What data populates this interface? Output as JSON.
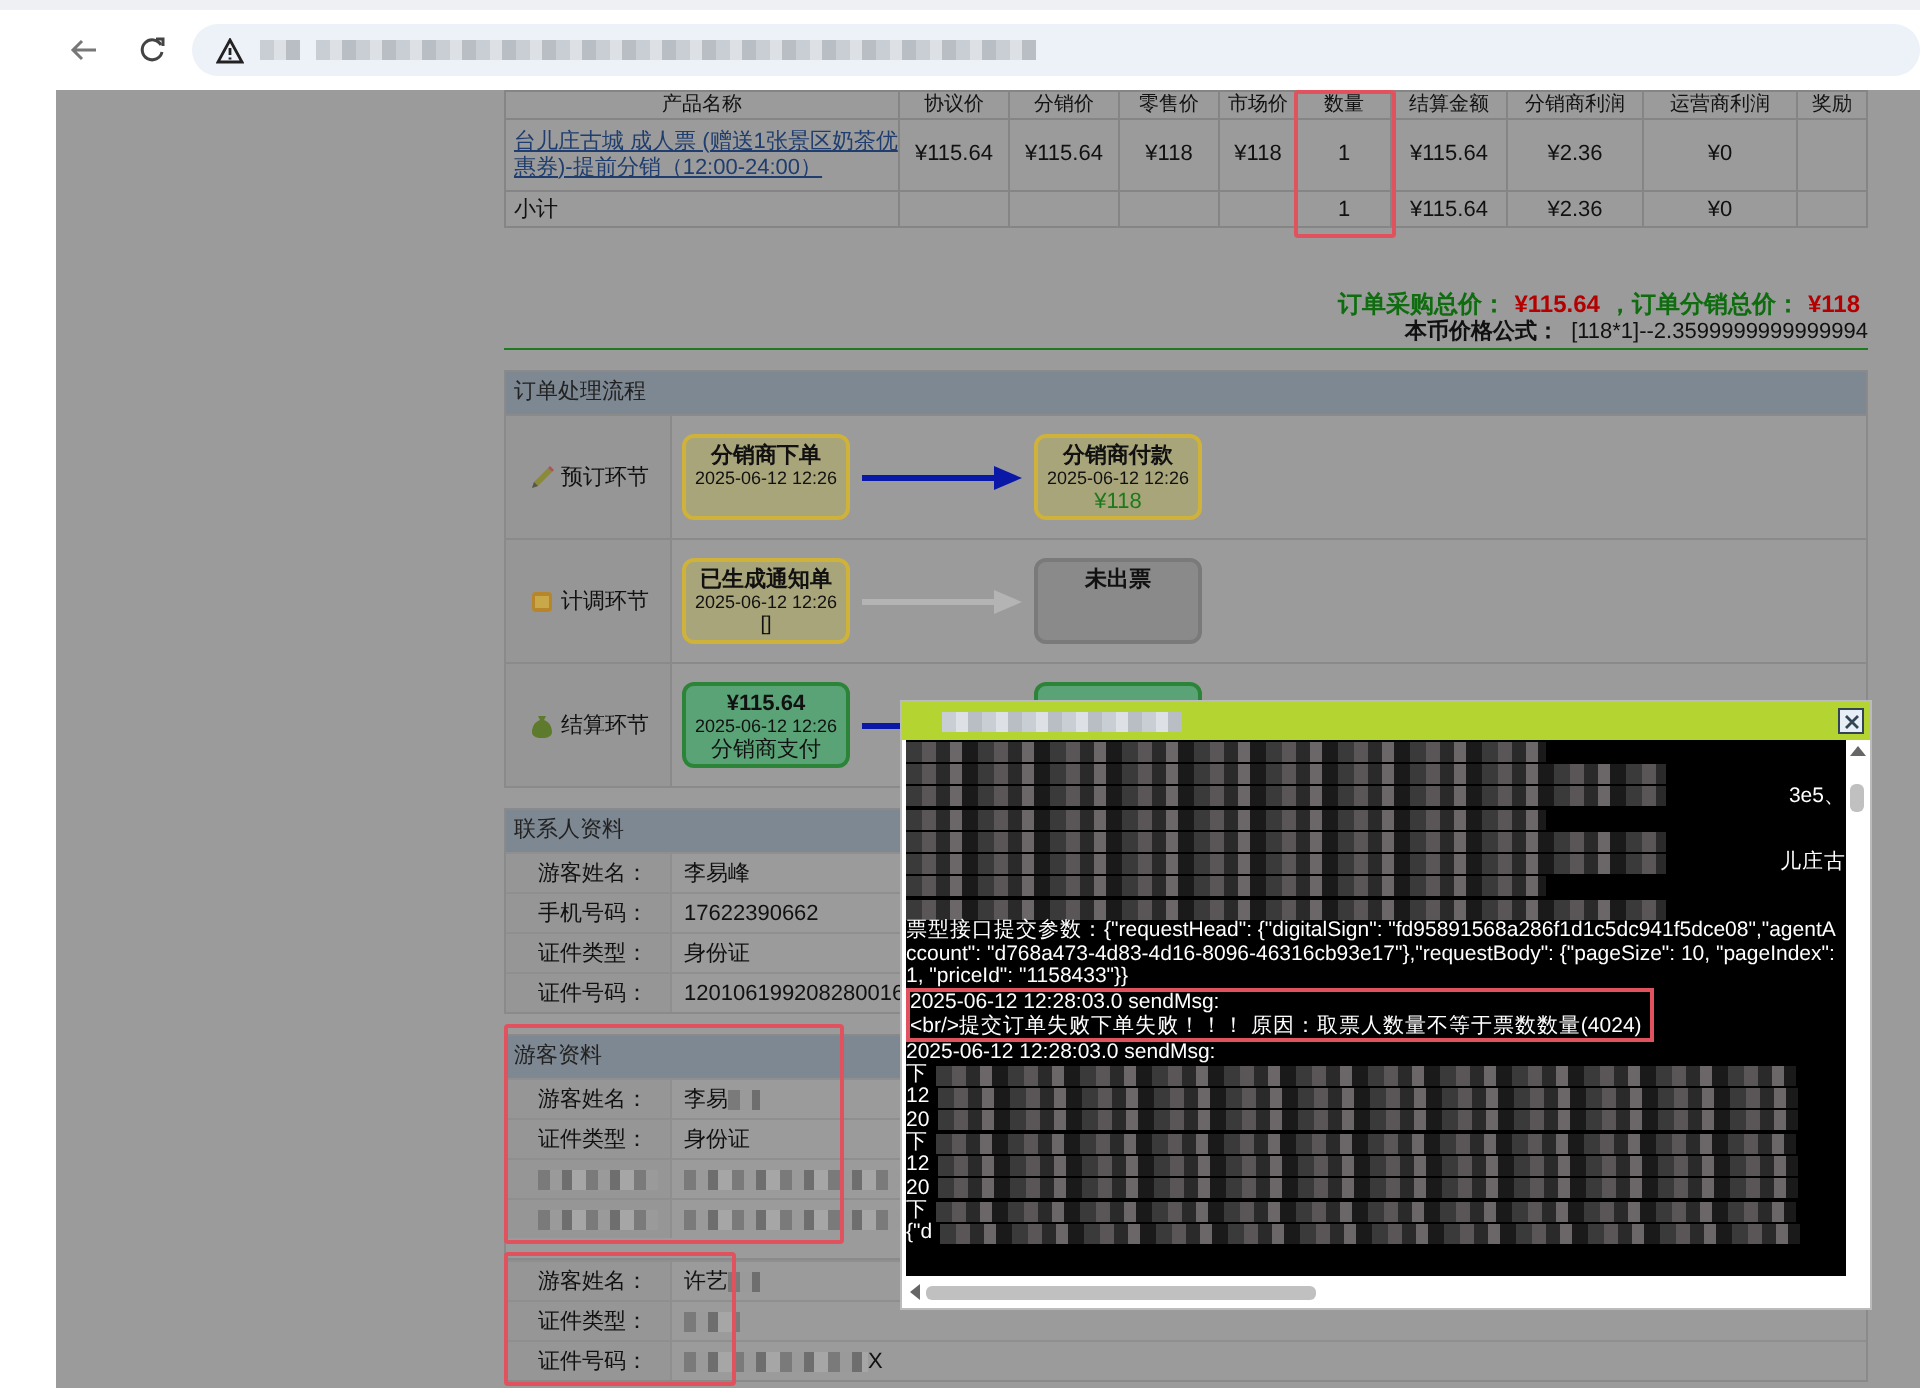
{
  "toolbar": {
    "address": {
      "redacted": true
    }
  },
  "product_table": {
    "columns": [
      {
        "label": "产品名称",
        "highlighted": false
      },
      {
        "label": "协议价",
        "highlighted": false
      },
      {
        "label": "分销价",
        "highlighted": false
      },
      {
        "label": "零售价",
        "highlighted": false
      },
      {
        "label": "市场价",
        "highlighted": false
      },
      {
        "label": "数量",
        "highlighted": true
      },
      {
        "label": "结算金额",
        "highlighted": false
      },
      {
        "label": "分销商利润",
        "highlighted": false
      },
      {
        "label": "运营商利润",
        "highlighted": false
      },
      {
        "label": "奖励",
        "highlighted": false
      }
    ],
    "rows": [
      {
        "kind": "item",
        "cells": [
          "台儿庄古城 成人票 (赠送1张景区奶茶优惠券)-提前分销（12:00-24:00）",
          "¥115.64",
          "¥115.64",
          "¥118",
          "¥118",
          "1",
          "¥115.64",
          "¥2.36",
          "¥0",
          null
        ]
      },
      {
        "kind": "subtotal",
        "cells": [
          "小计",
          null,
          null,
          null,
          null,
          "1",
          "¥115.64",
          "¥2.36",
          "¥0",
          null
        ]
      }
    ]
  },
  "totals": {
    "purchase_label": "订单采购总价：",
    "purchase_value": "¥115.64",
    "distribution_label": "，订单分销总价：",
    "distribution_value": "¥118",
    "formula_label": "本币价格公式：",
    "formula_value": "[118*1]--2.3599999999999994"
  },
  "flow": {
    "title": "订单处理流程",
    "stages": [
      {
        "label": "预订环节",
        "steps": [
          {
            "kind": "pending",
            "lines": [
              {
                "kind": "title",
                "text": "分销商下单"
              },
              {
                "kind": "time",
                "text": "2025-06-12 12:26"
              }
            ]
          },
          {
            "kind": "pending",
            "arrow_active": true,
            "lines": [
              {
                "kind": "title",
                "text": "分销商付款"
              },
              {
                "kind": "time",
                "text": "2025-06-12 12:26"
              },
              {
                "kind": "amount",
                "text": "¥118"
              }
            ]
          }
        ]
      },
      {
        "label": "计调环节",
        "steps": [
          {
            "kind": "pending",
            "lines": [
              {
                "kind": "title",
                "text": "已生成通知单"
              },
              {
                "kind": "time",
                "text": "2025-06-12 12:26"
              },
              {
                "kind": "note",
                "text": "[]"
              }
            ]
          },
          {
            "kind": "inactive",
            "arrow_active": false,
            "lines": [
              {
                "kind": "title",
                "text": "未出票"
              }
            ]
          }
        ]
      },
      {
        "label": "结算环节",
        "steps": [
          {
            "kind": "paid",
            "lines": [
              {
                "kind": "title",
                "text": "¥115.64"
              },
              {
                "kind": "time",
                "text": "2025-06-12 12:26"
              },
              {
                "kind": "big",
                "text": "分销商支付"
              }
            ]
          },
          {
            "kind": "paid",
            "arrow_active": true
          }
        ]
      }
    ]
  },
  "contact": {
    "title": "联系人资料",
    "fields": [
      {
        "label": "游客姓名：",
        "value": "李易峰"
      },
      {
        "label": "手机号码：",
        "value": "17622390662"
      },
      {
        "label": "证件类型：",
        "value": "身份证"
      },
      {
        "label": "证件号码：",
        "value": "120106199208280016"
      }
    ]
  },
  "tourists": {
    "title": "游客资料",
    "groups": [
      {
        "highlighted": true,
        "fields": [
          {
            "label": "游客姓名：",
            "value": "李易",
            "value_redacted": true
          },
          {
            "label": "证件类型：",
            "value": "身份证"
          },
          {
            "label_redacted": true,
            "value_redacted": true
          },
          {
            "label_redacted": true,
            "value_redacted": true
          }
        ]
      },
      {
        "highlighted": true,
        "fields": [
          {
            "label": "游客姓名：",
            "value": "许艺",
            "value_redacted": true
          },
          {
            "label": "证件类型：",
            "value_redacted": true
          },
          {
            "label": "证件号码：",
            "value_redacted": true,
            "value_suffix": "X"
          }
        ]
      }
    ]
  },
  "dialog": {
    "title": {
      "redacted": true
    },
    "lines": [
      {
        "kind": "redacted"
      },
      {
        "kind": "redacted"
      },
      {
        "kind": "redacted",
        "tail": "3e5、"
      },
      {
        "kind": "redacted"
      },
      {
        "kind": "redacted"
      },
      {
        "kind": "redacted",
        "tail": "儿庄古"
      },
      {
        "kind": "redacted"
      },
      {
        "kind": "redacted"
      },
      {
        "kind": "text",
        "highlighted": false,
        "text": "票型接口提交参数：{\"requestHead\": {\"digitalSign\": \"fd95891568a286f1d1c5dc941f5dce08\",\"agentAccount\": \"d768a473-4d83-4d16-8096-46316cb93e17\"},\"requestBody\": {\"pageSize\": 10, \"pageIndex\":1, \"priceId\": \"1158433\"}}"
      },
      {
        "kind": "text",
        "highlighted": true,
        "text": "2025-06-12 12:28:03.0 sendMsg:"
      },
      {
        "kind": "text",
        "highlighted": true,
        "text": "<br/>提交订单失败下单失败！！！ 原因：取票人数量不等于票数数量(4024)"
      },
      {
        "kind": "text",
        "highlighted": false,
        "text": "2025-06-12 12:28:03.0 sendMsg:"
      },
      {
        "kind": "redacted",
        "head": "下"
      },
      {
        "kind": "redacted",
        "head": "12"
      },
      {
        "kind": "redacted",
        "head": "20"
      },
      {
        "kind": "redacted",
        "head": "下"
      },
      {
        "kind": "redacted",
        "head": "12"
      },
      {
        "kind": "redacted",
        "head": "20"
      },
      {
        "kind": "redacted",
        "head": "下"
      },
      {
        "kind": "redacted",
        "head": "{\"d"
      }
    ]
  }
}
